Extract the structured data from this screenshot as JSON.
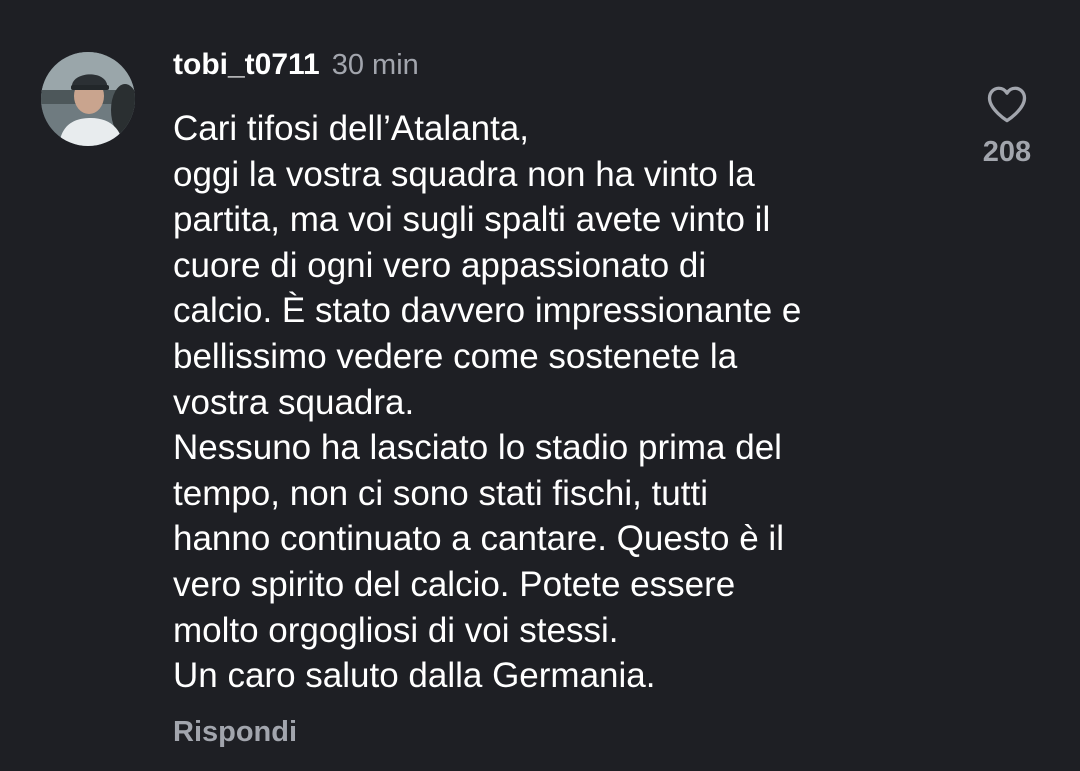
{
  "comment": {
    "username": "tobi_t0711",
    "time": "30 min",
    "text_lines": [
      "Cari tifosi dell’Atalanta,",
      "oggi la vostra squadra non ha vinto la",
      "partita, ma voi sugli spalti avete vinto il",
      "cuore di ogni vero appassionato di",
      "calcio. È stato davvero impressionante e",
      "bellissimo vedere come sostenete la",
      "vostra squadra.",
      "Nessuno ha lasciato lo stadio prima del",
      "tempo, non ci sono stati fischi, tutti",
      "hanno continuato a cantare. Questo è il",
      "vero spirito del calcio. Potete essere",
      "molto orgogliosi di voi stessi.",
      "Un caro saluto dalla Germania."
    ],
    "reply_label": "Rispondi",
    "like_count": "208",
    "like_icon": "heart-outline-icon",
    "avatar_icon": "user-avatar-photo"
  },
  "colors": {
    "background": "#1e1f24",
    "text": "#ffffff",
    "muted": "#a2a5ad"
  }
}
